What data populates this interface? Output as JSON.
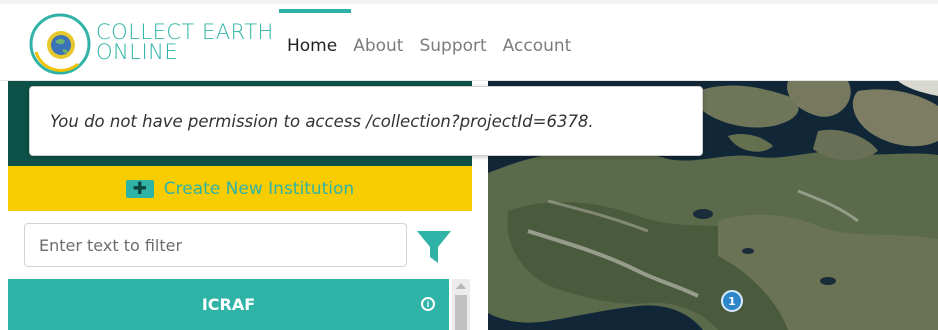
{
  "header": {
    "logo_line1": "COLLECT EARTH",
    "logo_line2": "ONLINE",
    "nav": [
      {
        "label": "Home",
        "active": true
      },
      {
        "label": "About",
        "active": false
      },
      {
        "label": "Support",
        "active": false
      },
      {
        "label": "Account",
        "active": false
      }
    ]
  },
  "alert": {
    "message": "You do not have permission to access /collection?projectId=6378."
  },
  "sidebar": {
    "create_label": "Create New Institution",
    "create_icon": "add-icon",
    "filter_placeholder": "Enter text to filter",
    "filter_value": "",
    "filter_icon": "funnel-icon",
    "institutions": [
      {
        "name": "ICRAF",
        "icon": "info-icon"
      }
    ]
  },
  "map": {
    "cluster_count": "1"
  },
  "colors": {
    "accent": "#2fb3a6",
    "create_bar": "#f7cc00",
    "dark_band": "#0d5148",
    "marker": "#2d86c9"
  }
}
